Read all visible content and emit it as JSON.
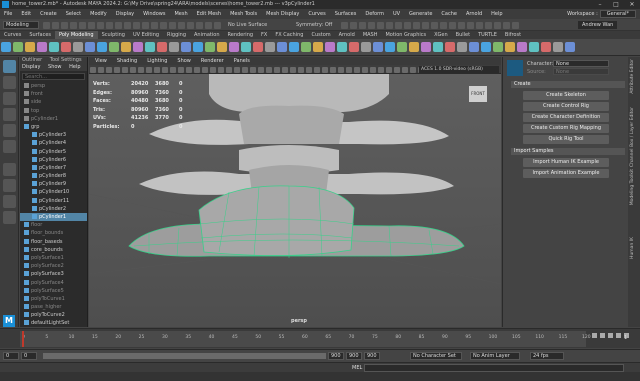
{
  "titlebar": {
    "title": "home_tower2.mb* - Autodesk MAYA 2024.2: G:\\My Drive\\spring24\\ARA\\models\\scenes\\home_tower2.mb  ---  v3pCylinder1"
  },
  "menubar": {
    "items": [
      "File",
      "Edit",
      "Create",
      "Select",
      "Modify",
      "Display",
      "Windows",
      "Mesh",
      "Edit Mesh",
      "Mesh Tools",
      "Mesh Display",
      "Curves",
      "Surfaces",
      "Deform",
      "UV",
      "Generate",
      "Cache",
      "Arnold",
      "Help"
    ]
  },
  "workspace": {
    "label": "Workspace :",
    "value": "General*"
  },
  "statusline": {
    "mode": "Modeling",
    "live_surface": "No Live Surface",
    "symmetry": "Symmetry: Off",
    "user": "Andrew Wan"
  },
  "shelf": {
    "tabs": [
      "Curves",
      "Surfaces",
      "Poly Modeling",
      "Sculpting",
      "UV Editing",
      "Rigging",
      "Animation",
      "Rendering",
      "FX",
      "FX Caching",
      "Custom",
      "Arnold",
      "MASH",
      "Motion Graphics",
      "XGen",
      "Bullet",
      "TURTLE",
      "Bifrost"
    ],
    "active_tab": "Poly Modeling"
  },
  "outliner": {
    "title": "Outliner",
    "tool_settings": "Tool Settings",
    "menus": [
      "Display",
      "Show",
      "Help"
    ],
    "search_placeholder": "Search...",
    "rows": [
      {
        "label": "persp",
        "state": "dim"
      },
      {
        "label": "front",
        "state": "dim"
      },
      {
        "label": "side",
        "state": "dim"
      },
      {
        "label": "top",
        "state": "dim"
      },
      {
        "label": "pCylinder1",
        "state": "dim"
      },
      {
        "label": "grp",
        "state": ""
      },
      {
        "label": "pCylinder3",
        "state": ""
      },
      {
        "label": "pCylinder4",
        "state": ""
      },
      {
        "label": "pCylinder5",
        "state": ""
      },
      {
        "label": "pCylinder6",
        "state": ""
      },
      {
        "label": "pCylinder7",
        "state": ""
      },
      {
        "label": "pCylinder8",
        "state": ""
      },
      {
        "label": "pCylinder9",
        "state": ""
      },
      {
        "label": "pCylinder10",
        "state": ""
      },
      {
        "label": "pCylinder11",
        "state": ""
      },
      {
        "label": "pCylinder2",
        "state": ""
      },
      {
        "label": "pCylinder1",
        "state": "selected"
      },
      {
        "label": "floor",
        "state": "dim"
      },
      {
        "label": "floor_bounds",
        "state": "dim"
      },
      {
        "label": "floor_baseds",
        "state": ""
      },
      {
        "label": "core_bounds",
        "state": ""
      },
      {
        "label": "polySurface1",
        "state": "dim"
      },
      {
        "label": "polySurface2",
        "state": "dim"
      },
      {
        "label": "polySurface3",
        "state": ""
      },
      {
        "label": "polySurface4",
        "state": "dim"
      },
      {
        "label": "polySurface5",
        "state": "dim"
      },
      {
        "label": "polyToCurve1",
        "state": "dim"
      },
      {
        "label": "pase_higher",
        "state": "dim"
      },
      {
        "label": "polyToCurve2",
        "state": ""
      },
      {
        "label": "defaultLightSet",
        "state": ""
      },
      {
        "label": "defaultObjectSet",
        "state": ""
      },
      {
        "label": "curve",
        "state": ""
      }
    ]
  },
  "viewport": {
    "menus": [
      "View",
      "Shading",
      "Lighting",
      "Show",
      "Renderer",
      "Panels"
    ],
    "color_space": "ACES 1.0 SDR-video (sRGB)",
    "camera": "persp",
    "hud": [
      {
        "label": "Verts:",
        "total": "20420",
        "sel": "3680",
        "extra": "0"
      },
      {
        "label": "Edges:",
        "total": "80960",
        "sel": "7360",
        "extra": "0"
      },
      {
        "label": "Faces:",
        "total": "40480",
        "sel": "3680",
        "extra": "0"
      },
      {
        "label": "Tris:",
        "total": "80960",
        "sel": "7360",
        "extra": "0"
      },
      {
        "label": "UVs:",
        "total": "41236",
        "sel": "3770",
        "extra": "0"
      },
      {
        "label": "Particles:",
        "total": "0",
        "sel": "",
        "extra": "0"
      }
    ]
  },
  "hik": {
    "character_label": "Character:",
    "character_value": "None",
    "source_label": "Source:",
    "source_value": "None",
    "sections": [
      {
        "title": "Create",
        "buttons": [
          "Create Skeleton",
          "Create Control Rig",
          "Create Character Definition",
          "Create Custom Rig Mapping",
          "Quick Rig Tool"
        ]
      },
      {
        "title": "Import Samples",
        "buttons": [
          "Import Human IK Example",
          "Import Animation Example"
        ]
      }
    ]
  },
  "sidetabs": [
    "Attribute Editor",
    "Channel Box / Layer Editor",
    "Modeling Toolkit",
    "Human IK"
  ],
  "timeline": {
    "ticks": [
      "0",
      "5",
      "10",
      "15",
      "20",
      "25",
      "30",
      "35",
      "40",
      "45",
      "50",
      "55",
      "60",
      "65",
      "70",
      "75",
      "80",
      "85",
      "90",
      "95",
      "100",
      "105",
      "110",
      "115",
      "120"
    ],
    "current_frame": "1"
  },
  "range": {
    "start": "0",
    "anim_start": "0",
    "range_start": "1",
    "range_end": "900",
    "anim_end": "900",
    "end": "900",
    "character_set": "No Character Set",
    "anim_layer": "No Anim Layer",
    "fps": "24 fps"
  },
  "cmdline": {
    "lang": "MEL"
  }
}
